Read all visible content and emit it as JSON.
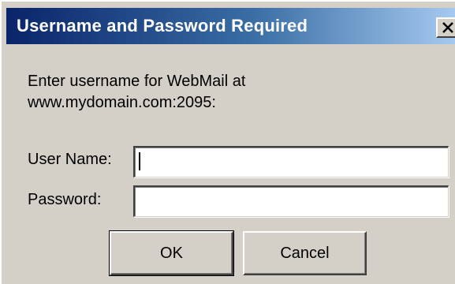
{
  "window": {
    "title": "Username and Password Required",
    "close_glyph": "✕"
  },
  "prompt": {
    "line1": "Enter username for WebMail at",
    "line2": "www.mydomain.com:2095:"
  },
  "form": {
    "username_label": "User Name:",
    "username_value": "",
    "password_label": "Password:",
    "password_value": ""
  },
  "buttons": {
    "ok_label": "OK",
    "cancel_label": "Cancel"
  },
  "colors": {
    "face": "#d4d0c8",
    "title_start": "#0a246a",
    "title_end": "#a6caf0"
  }
}
